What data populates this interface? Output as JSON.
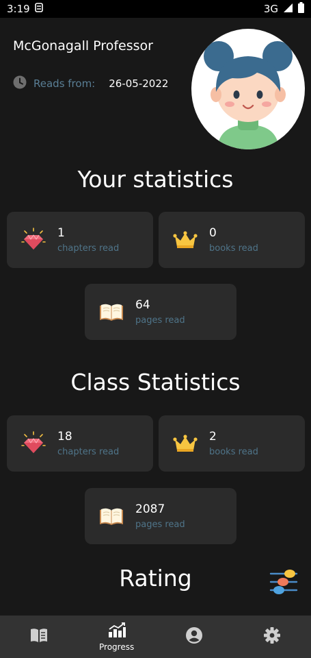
{
  "status_bar": {
    "time": "3:19",
    "network": "3G"
  },
  "profile": {
    "name": "McGonagall Professor",
    "reads_label": "Reads from:",
    "reads_date": "26-05-2022"
  },
  "your_stats": {
    "title": "Your statistics",
    "chapters": {
      "value": "1",
      "label": "chapters read"
    },
    "books": {
      "value": "0",
      "label": "books read"
    },
    "pages": {
      "value": "64",
      "label": "pages read"
    }
  },
  "class_stats": {
    "title": "Class Statistics",
    "chapters": {
      "value": "18",
      "label": "chapters read"
    },
    "books": {
      "value": "2",
      "label": "books read"
    },
    "pages": {
      "value": "2087",
      "label": "pages read"
    }
  },
  "rating": {
    "title": "Rating"
  },
  "nav": {
    "progress_label": "Progress"
  },
  "colors": {
    "background": "#181818",
    "card": "#2b2b2b",
    "label": "#4f7489",
    "nav": "#333333"
  }
}
